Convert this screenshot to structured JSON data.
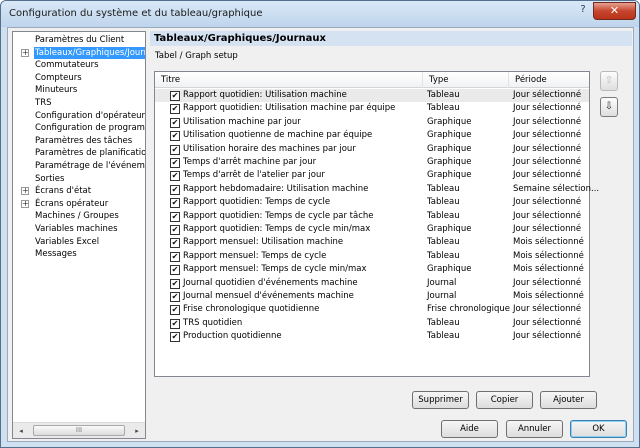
{
  "window": {
    "title": "Configuration du système et du tableau/graphique",
    "help": "?",
    "close": "✕"
  },
  "tree": {
    "items": [
      {
        "label": "Paramètres du Client",
        "expandable": false,
        "selected": false
      },
      {
        "label": "Tableaux/Graphiques/Journaux",
        "expandable": true,
        "selected": true
      },
      {
        "label": "Commutateurs",
        "expandable": false,
        "selected": false
      },
      {
        "label": "Compteurs",
        "expandable": false,
        "selected": false
      },
      {
        "label": "Minuteurs",
        "expandable": false,
        "selected": false
      },
      {
        "label": "TRS",
        "expandable": false,
        "selected": false
      },
      {
        "label": "Configuration d'opérateur",
        "expandable": false,
        "selected": false
      },
      {
        "label": "Configuration de programme",
        "expandable": false,
        "selected": false
      },
      {
        "label": "Paramètres des tâches",
        "expandable": false,
        "selected": false
      },
      {
        "label": "Paramètres de planification",
        "expandable": false,
        "selected": false
      },
      {
        "label": "Paramétrage de l'événement",
        "expandable": false,
        "selected": false
      },
      {
        "label": "Sorties",
        "expandable": false,
        "selected": false
      },
      {
        "label": "Écrans d'état",
        "expandable": true,
        "selected": false
      },
      {
        "label": "Écrans opérateur",
        "expandable": true,
        "selected": false
      },
      {
        "label": "Machines / Groupes",
        "expandable": false,
        "selected": false
      },
      {
        "label": "Variables machines",
        "expandable": false,
        "selected": false
      },
      {
        "label": "Variables Excel",
        "expandable": false,
        "selected": false
      },
      {
        "label": "Messages",
        "expandable": false,
        "selected": false
      }
    ],
    "scroll_left": "◂",
    "scroll_right": "▸",
    "scroll_grip": "III"
  },
  "panel": {
    "title": "Tableaux/Graphiques/Journaux",
    "subtitle": "Tabel / Graph setup"
  },
  "table": {
    "columns": [
      "Titre",
      "Type",
      "Période"
    ],
    "rows": [
      {
        "title": "Rapport quotidien: Utilisation machine",
        "type": "Tableau",
        "period": "Jour sélectionné",
        "checked": true
      },
      {
        "title": "Rapport quotidien: Utilisation machine par équipe",
        "type": "Tableau",
        "period": "Jour sélectionné",
        "checked": true
      },
      {
        "title": "Utilisation machine par jour",
        "type": "Graphique",
        "period": "Jour sélectionné",
        "checked": true
      },
      {
        "title": "Utilisation quotienne de machine par équipe",
        "type": "Graphique",
        "period": "Jour sélectionné",
        "checked": true
      },
      {
        "title": "Utilisation horaire des machines par jour",
        "type": "Graphique",
        "period": "Jour sélectionné",
        "checked": true
      },
      {
        "title": "Temps d'arrêt machine par jour",
        "type": "Graphique",
        "period": "Jour sélectionné",
        "checked": true
      },
      {
        "title": "Temps d'arrêt de l'atelier par jour",
        "type": "Graphique",
        "period": "Jour sélectionné",
        "checked": true
      },
      {
        "title": "Rapport hebdomadaire: Utilisation machine",
        "type": "Tableau",
        "period": "Semaine sélection...",
        "checked": true
      },
      {
        "title": "Rapport quotidien: Temps de cycle",
        "type": "Tableau",
        "period": "Jour sélectionné",
        "checked": true
      },
      {
        "title": "Rapport quotidien: Temps de cycle par tâche",
        "type": "Tableau",
        "period": "Jour sélectionné",
        "checked": true
      },
      {
        "title": "Rapport quotidien: Temps de cycle min/max",
        "type": "Graphique",
        "period": "Jour sélectionné",
        "checked": true
      },
      {
        "title": "Rapport mensuel: Utilisation machine",
        "type": "Tableau",
        "period": "Mois sélectionné",
        "checked": true
      },
      {
        "title": "Rapport mensuel: Temps de cycle",
        "type": "Tableau",
        "period": "Mois sélectionné",
        "checked": true
      },
      {
        "title": "Rapport mensuel: Temps de cycle min/max",
        "type": "Graphique",
        "period": "Mois sélectionné",
        "checked": true
      },
      {
        "title": "Journal quotidien d'événements machine",
        "type": "Journal",
        "period": "Jour sélectionné",
        "checked": true
      },
      {
        "title": "Journal mensuel d'événements machine",
        "type": "Journal",
        "period": "Mois sélectionné",
        "checked": true
      },
      {
        "title": "Frise chronologique quotidienne",
        "type": "Frise chronologique",
        "period": "Jour sélectionné",
        "checked": true
      },
      {
        "title": "TRS quotidien",
        "type": "Tableau",
        "period": "Jour sélectionné",
        "checked": true
      },
      {
        "title": "Production quotidienne",
        "type": "Tableau",
        "period": "Jour sélectionné",
        "checked": true
      }
    ],
    "check_mark": "✔"
  },
  "side_buttons": {
    "move_up": "⇧",
    "move_down": "⇩"
  },
  "actions": {
    "delete": "Supprimer",
    "copy": "Copier",
    "add": "Ajouter"
  },
  "footer": {
    "help": "Aide",
    "cancel": "Annuler",
    "ok": "OK"
  }
}
